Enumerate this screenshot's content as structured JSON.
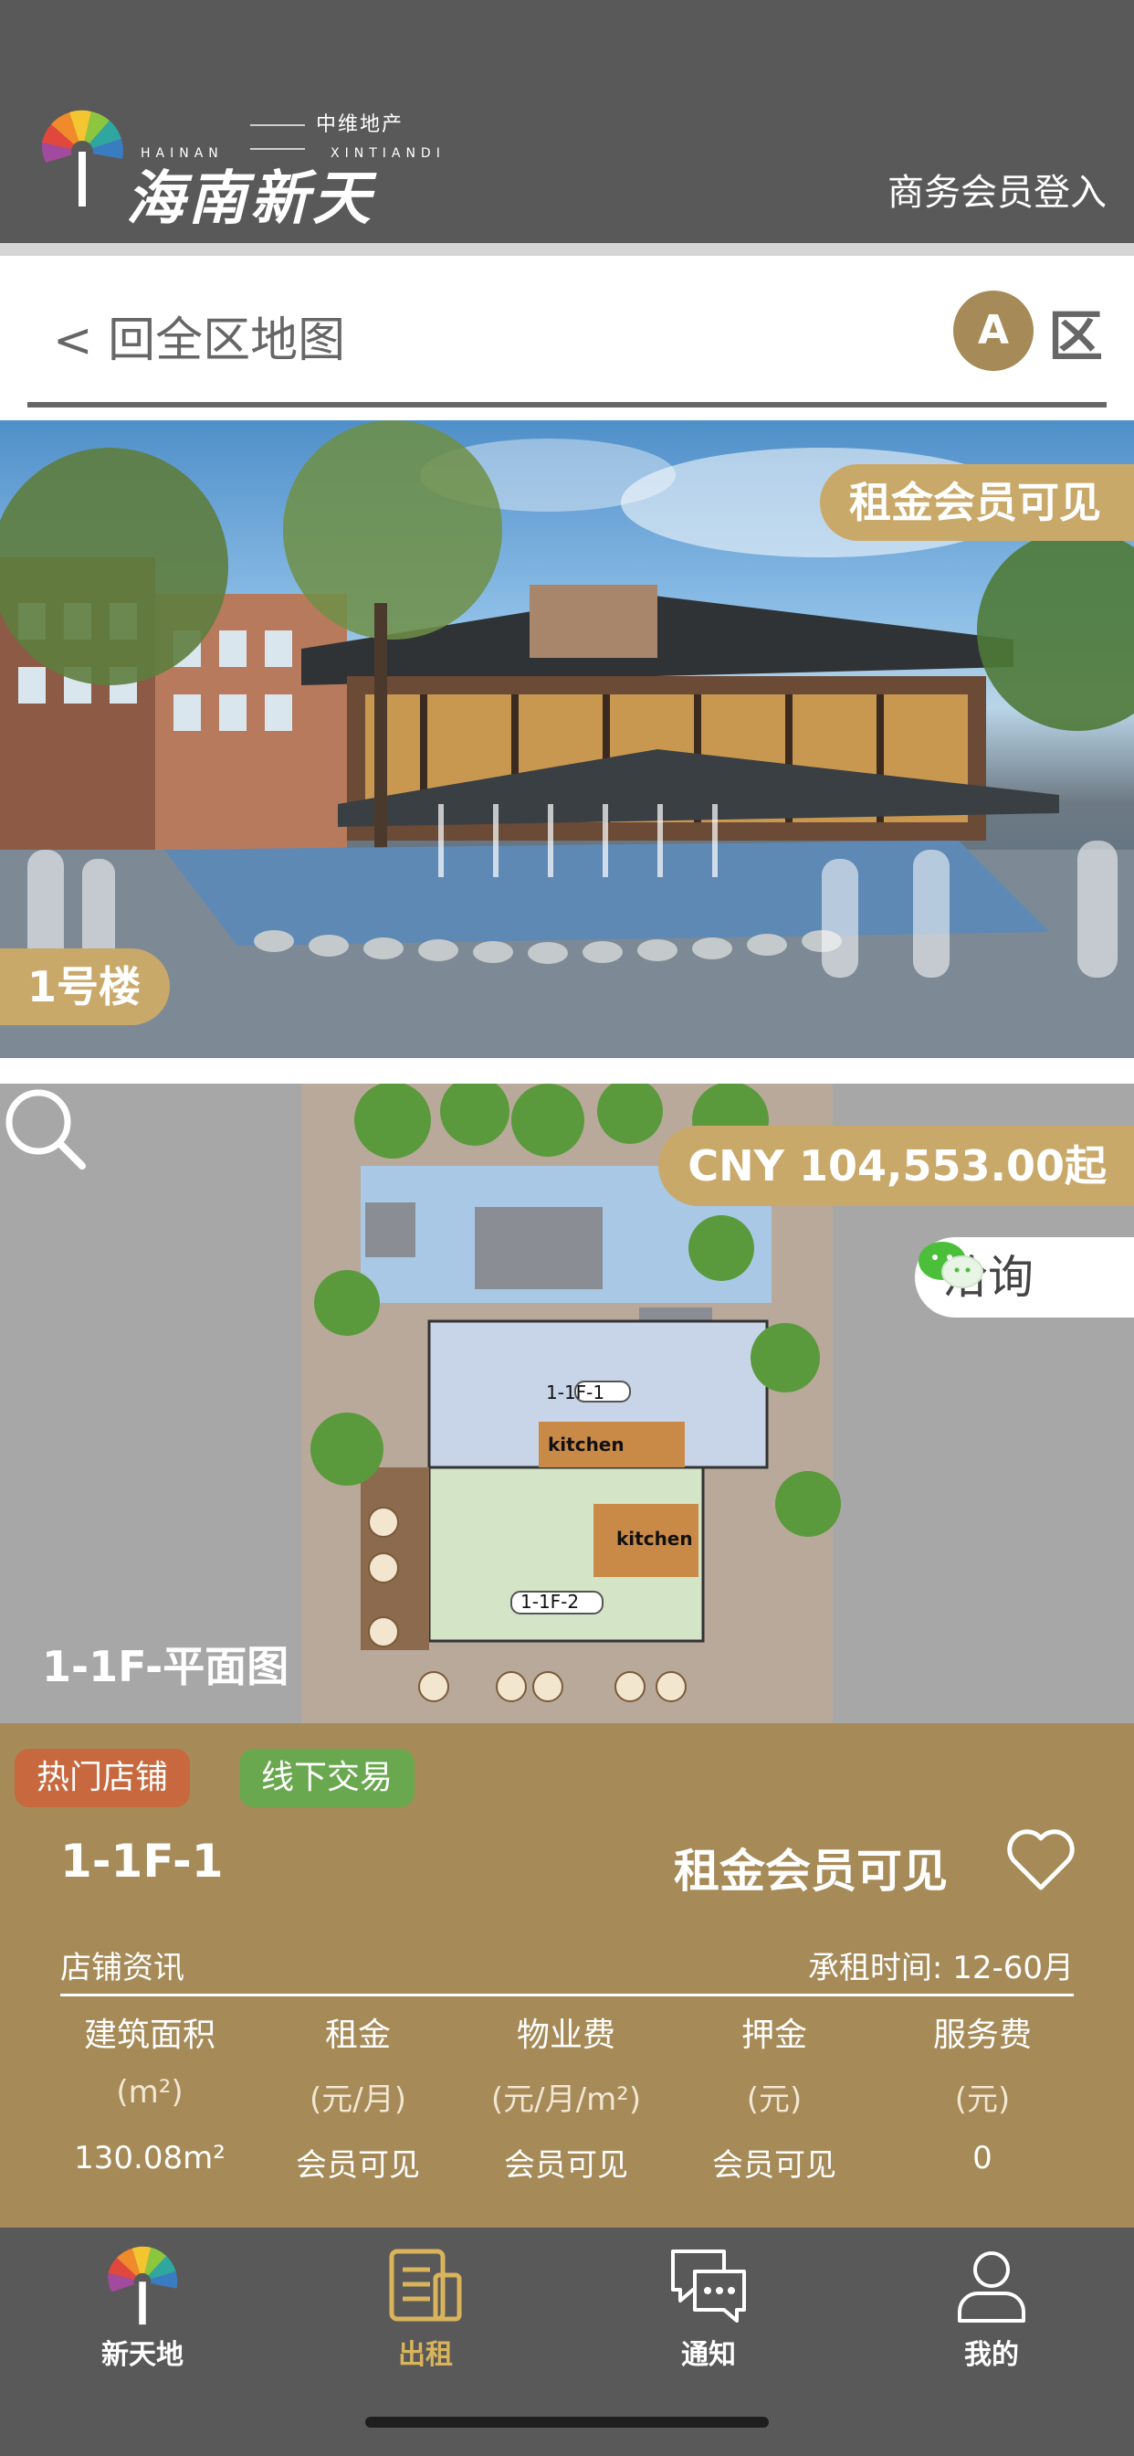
{
  "header": {
    "logo_small_cn": "中维地产",
    "logo_en_left": "HAINAN",
    "logo_en_right": "XINTIANDI",
    "logo_cn": "海南新天地",
    "login_label": "商务会员登入"
  },
  "backbar": {
    "back_label": "< 回全区地图",
    "zone_letter": "A",
    "zone_label": "区"
  },
  "hero": {
    "rent_badge": "租金会员可见",
    "building_label": "1号楼"
  },
  "plan": {
    "price": "CNY 104,553.00起",
    "consult_label": "洽询",
    "plan_title": "1-1F-平面图",
    "room_labels": [
      "1-1F-1",
      "1-1F-2",
      "kitchen",
      "kitchen"
    ]
  },
  "info": {
    "tag_hot": "热门店铺",
    "tag_offline": "线下交易",
    "unit_name": "1-1F-1",
    "rent_visibility": "租金会员可见",
    "section_title": "店铺资讯",
    "lease_term": "承租时间: 12-60月",
    "columns": [
      {
        "head": "建筑面积",
        "unit": "(m²)",
        "value": "130.08m²"
      },
      {
        "head": "租金",
        "unit": "(元/月)",
        "value": "会员可见"
      },
      {
        "head": "物业费",
        "unit": "(元/月/m²)",
        "value": "会员可见"
      },
      {
        "head": "押金",
        "unit": "(元)",
        "value": "会员可见"
      },
      {
        "head": "服务费",
        "unit": "(元)",
        "value": "0"
      }
    ]
  },
  "tabbar": {
    "tabs": [
      {
        "label": "新天地",
        "icon": "logo-fan-icon",
        "active": false
      },
      {
        "label": "出租",
        "icon": "document-icon",
        "active": true
      },
      {
        "label": "通知",
        "icon": "chat-bubble-icon",
        "active": false
      },
      {
        "label": "我的",
        "icon": "user-icon",
        "active": false
      }
    ],
    "active_color": "#d9b45b"
  },
  "colors": {
    "header_bg": "#595959",
    "accent_gold": "#c9a96a",
    "panel_brown": "#a68a57",
    "tag_hot": "#c8683e",
    "tag_offline": "#6aa84f"
  }
}
